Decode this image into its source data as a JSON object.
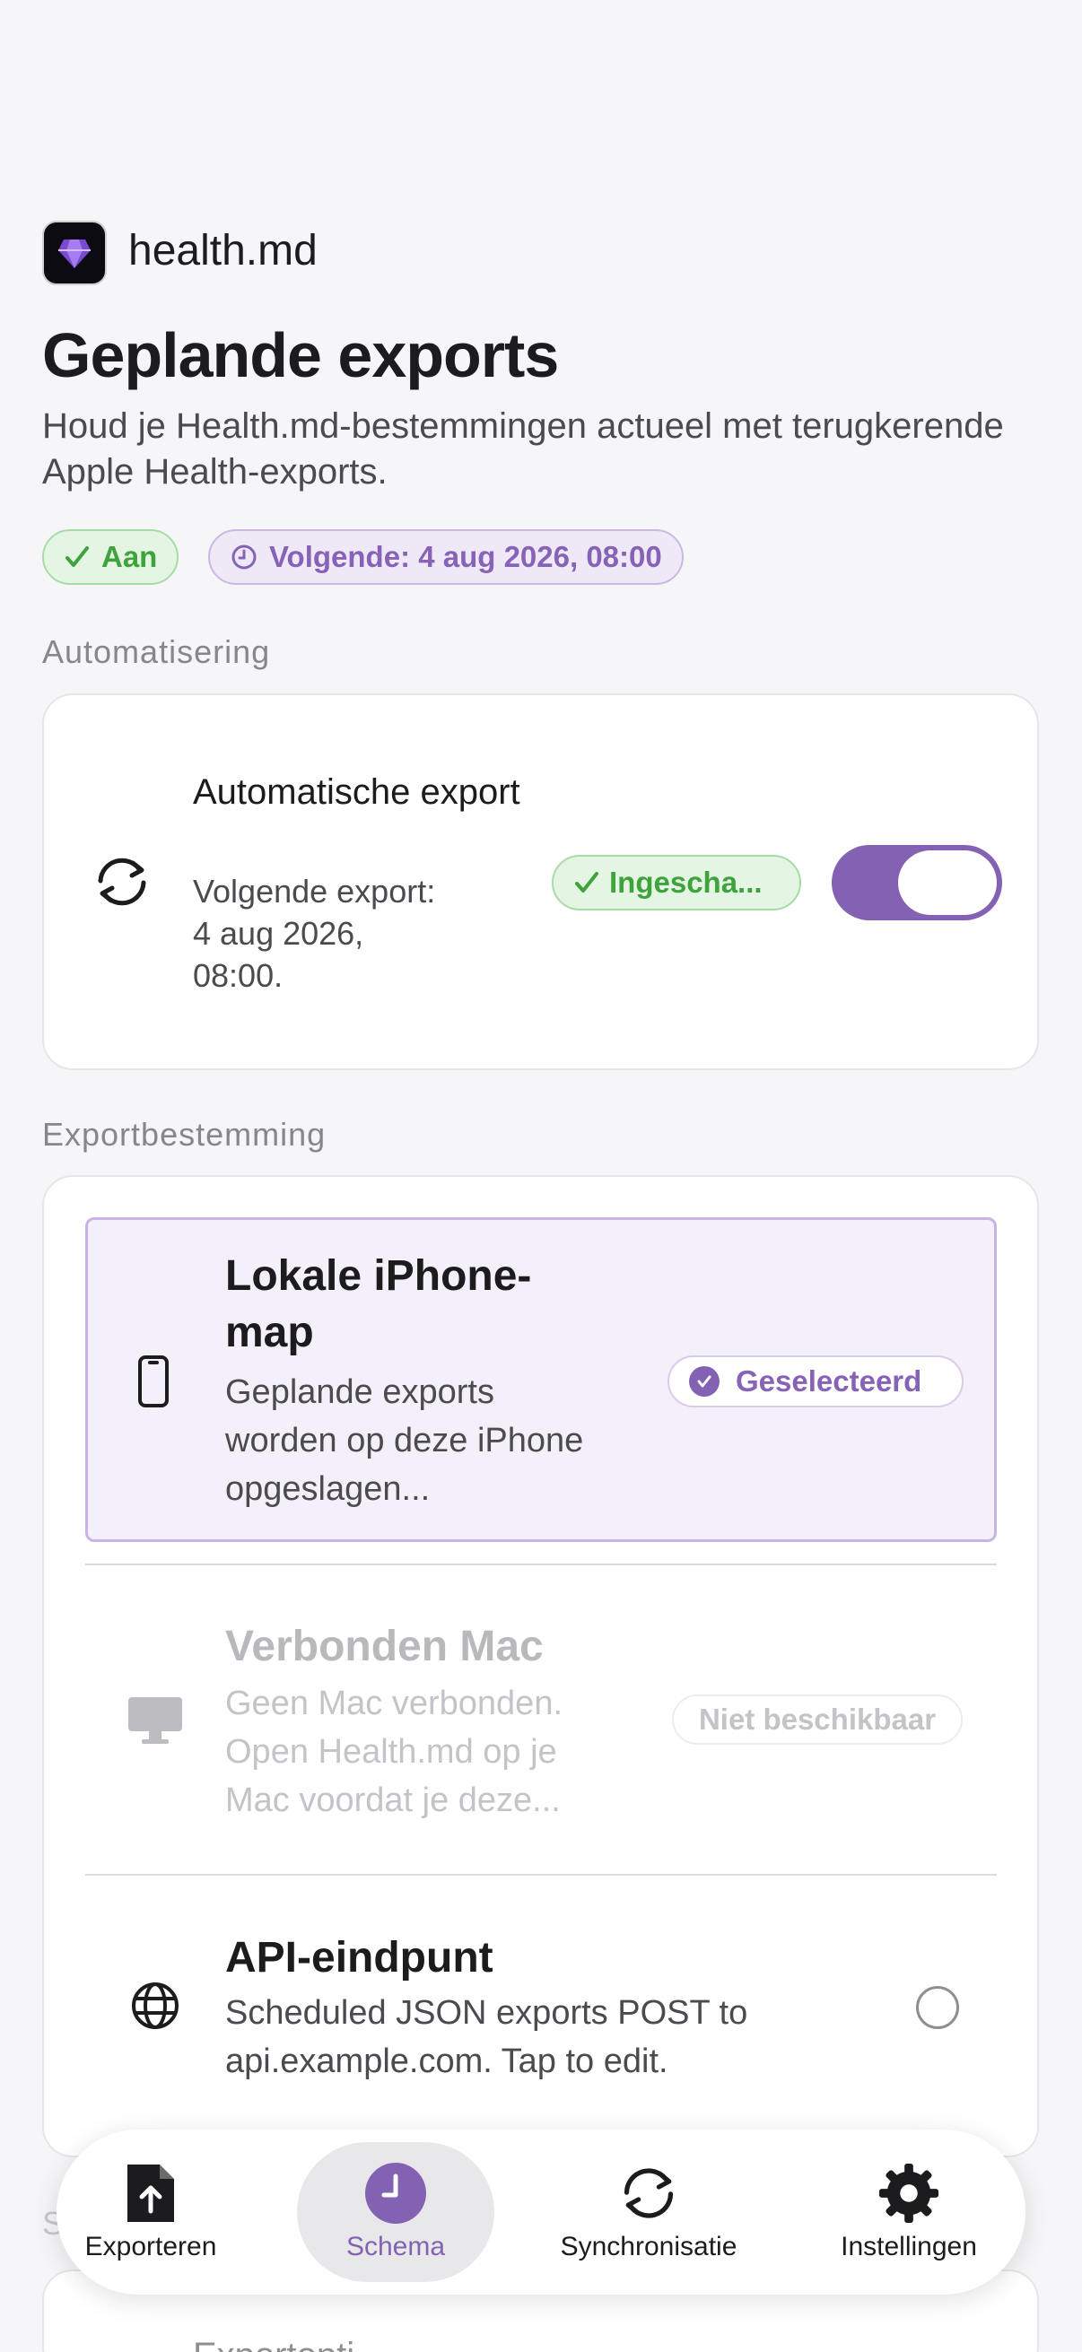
{
  "app": {
    "name": "health.md"
  },
  "page": {
    "title": "Geplande exports",
    "subtitle": "Houd je Health.md-bestemmingen actueel met terugkerende Apple Health-exports."
  },
  "status": {
    "on_label": "Aan",
    "next_label": "Volgende: 4 aug 2026, 08:00"
  },
  "automation": {
    "section_label": "Automatisering",
    "title": "Automatische export",
    "subtitle": "Volgende export: 4 aug 2026, 08:00.",
    "badge": "Ingescha...",
    "enabled": true
  },
  "destination": {
    "section_label": "Exportbestemming",
    "options": [
      {
        "title": "Lokale iPhone-map",
        "description": "Geplande exports worden op deze iPhone opgeslagen...",
        "badge": "Geselecteerd",
        "icon": "iphone-icon",
        "state": "selected"
      },
      {
        "title": "Verbonden Mac",
        "description": "Geen Mac verbonden. Open Health.md op je Mac voordat je deze...",
        "badge": "Niet beschikbaar",
        "icon": "desktop-icon",
        "state": "disabled"
      },
      {
        "title": "API-eindpunt",
        "description": "Scheduled JSON exports POST to api.example.com. Tap to edit.",
        "icon": "globe-icon",
        "state": "unselected"
      }
    ]
  },
  "peek": {
    "section_label": "S",
    "item": "Exportopti..."
  },
  "tabs": [
    {
      "label": "Exporteren",
      "icon": "export-document-icon"
    },
    {
      "label": "Schema",
      "icon": "clock-icon",
      "active": true
    },
    {
      "label": "Synchronisatie",
      "icon": "sync-icon"
    },
    {
      "label": "Instellingen",
      "icon": "gear-icon"
    }
  ],
  "colors": {
    "accent": "#8462b3",
    "success": "#3ea33b",
    "background": "#f6f6f8"
  }
}
